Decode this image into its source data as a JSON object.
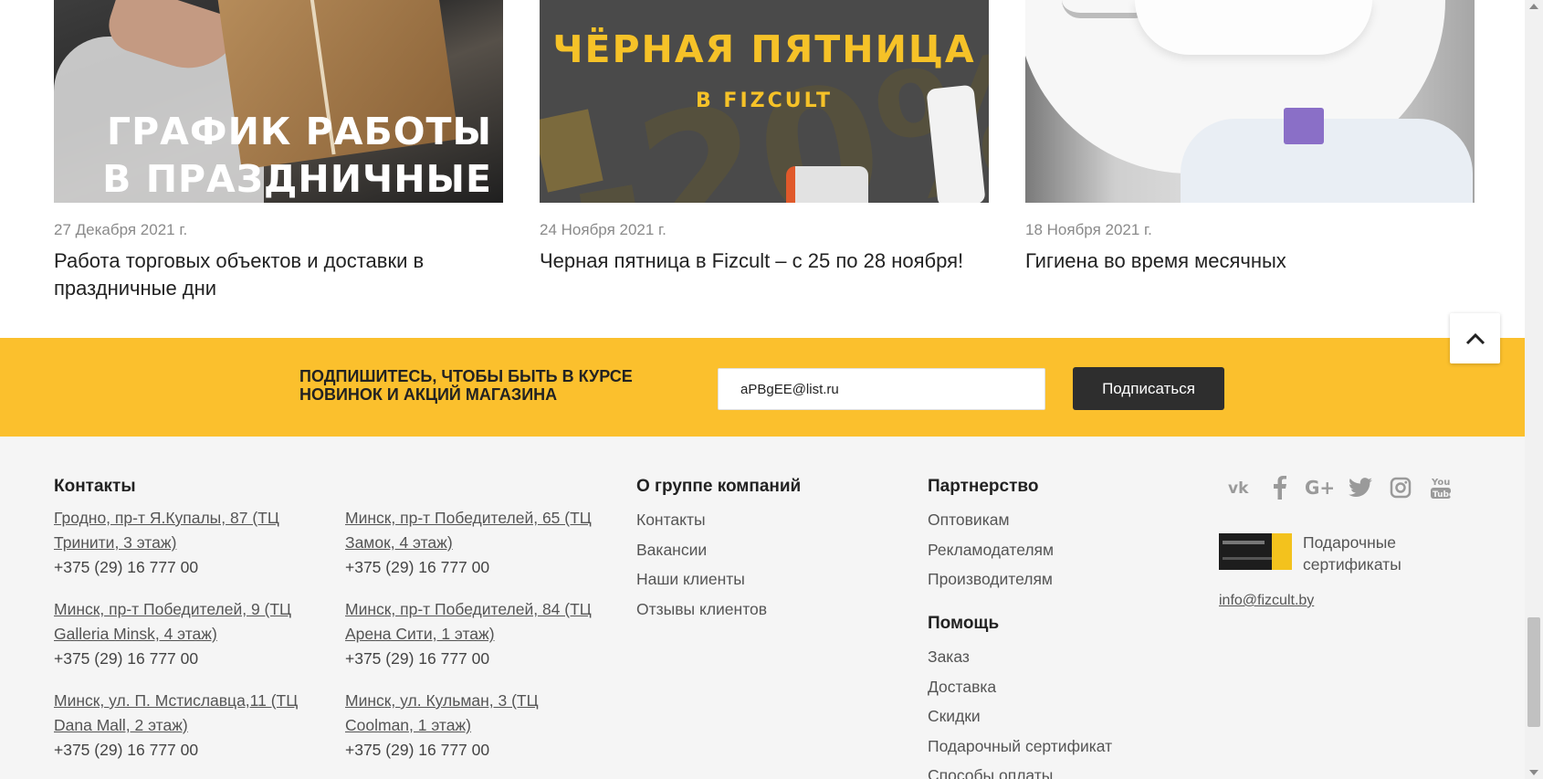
{
  "news": [
    {
      "image_caption_line1": "ГРАФИК РАБОТЫ",
      "image_caption_line2": "В ПРАЗДНИЧНЫЕ ДНИ",
      "date": "27 Декабря 2021 г.",
      "title": "Работа торговых объектов и доставки в праздничные дни"
    },
    {
      "image_caption_line1": "ЧЁРНАЯ ПЯТНИЦА",
      "image_caption_line2": "В FIZCULT",
      "date": "24 Ноября 2021 г.",
      "title": "Черная пятница в Fizcult – с 25 по 28 ноября!"
    },
    {
      "date": "18 Ноября 2021 г.",
      "title": "Гигиена во время месячных"
    }
  ],
  "subscribe": {
    "text": "Подпишитесь, чтобы быть в курсе новинок и акций магазина",
    "email_value": "aPBgEE@list.ru",
    "button_label": "Подписаться",
    "background_color": "#fbc02d"
  },
  "footer": {
    "contacts_heading": "Контакты",
    "contacts": [
      {
        "address": "Гродно, пр-т Я.Купалы, 87 (ТЦ Тринити, 3 этаж)",
        "phone": "+375 (29) 16 777 00"
      },
      {
        "address": "Минск, пр-т Победителей, 65 (ТЦ Замок, 4 этаж)",
        "phone": "+375 (29) 16 777 00"
      },
      {
        "address": "Минск, пр-т Победителей, 9 (ТЦ Galleria Minsk, 4 этаж)",
        "phone": "+375 (29) 16 777 00"
      },
      {
        "address": "Минск, пр-т Победителей, 84 (ТЦ Арена Сити, 1 этаж)",
        "phone": "+375 (29) 16 777 00"
      },
      {
        "address": "Минск, ул. П. Мстиславца,11 (ТЦ Dana Mall, 2 этаж)",
        "phone": "+375 (29) 16 777 00"
      },
      {
        "address": "Минск, ул. Кульман, 3 (ТЦ Coolman, 1 этаж)",
        "phone": "+375 (29) 16 777 00"
      }
    ],
    "about_heading": "О группе компаний",
    "about_links": [
      "Контакты",
      "Вакансии",
      "Наши клиенты",
      "Отзывы клиентов"
    ],
    "partner_heading": "Партнерство",
    "partner_links": [
      "Оптовикам",
      "Рекламодателям",
      "Производителям"
    ],
    "help_heading": "Помощь",
    "help_links": [
      "Заказ",
      "Доставка",
      "Скидки",
      "Подарочный сертификат",
      "Способы оплаты"
    ],
    "socials": [
      "vk-icon",
      "facebook-icon",
      "google-plus-icon",
      "twitter-icon",
      "instagram-icon",
      "youtube-icon"
    ],
    "gift_label": "Подарочные сертификаты",
    "email": "info@fizcult.by"
  }
}
